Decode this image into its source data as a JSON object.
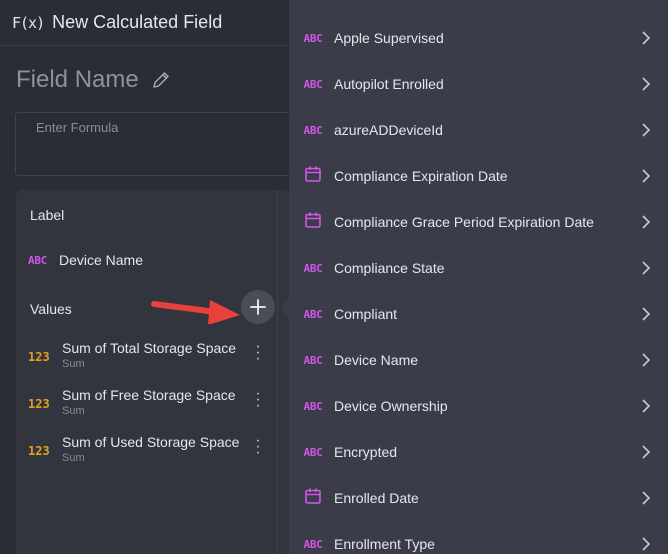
{
  "header": {
    "fx_icon": "F(x)",
    "title": "New Calculated Field"
  },
  "field_name": {
    "title": "Field Name",
    "edit_icon": "pencil-icon"
  },
  "formula": {
    "placeholder": "Enter Formula"
  },
  "label_section": {
    "heading": "Label",
    "item": {
      "badge": "ABC",
      "name": "Device Name"
    }
  },
  "values_section": {
    "heading": "Values",
    "items": [
      {
        "badge": "123",
        "name": "Sum of Total Storage Space",
        "agg": "Sum"
      },
      {
        "badge": "123",
        "name": "Sum of Free Storage Space",
        "agg": "Sum"
      },
      {
        "badge": "123",
        "name": "Sum of Used Storage Space",
        "agg": "Sum"
      }
    ]
  },
  "add_button": {
    "icon": "plus-icon"
  },
  "dropdown": {
    "items": [
      {
        "type": "text",
        "badge": "ABC",
        "label": "Apple Supervised"
      },
      {
        "type": "text",
        "badge": "ABC",
        "label": "Autopilot Enrolled"
      },
      {
        "type": "text",
        "badge": "ABC",
        "label": "azureADDeviceId"
      },
      {
        "type": "date",
        "badge": "",
        "label": "Compliance Expiration Date"
      },
      {
        "type": "date",
        "badge": "",
        "label": "Compliance Grace Period Expiration Date"
      },
      {
        "type": "text",
        "badge": "ABC",
        "label": "Compliance State"
      },
      {
        "type": "text",
        "badge": "ABC",
        "label": "Compliant"
      },
      {
        "type": "text",
        "badge": "ABC",
        "label": "Device Name"
      },
      {
        "type": "text",
        "badge": "ABC",
        "label": "Device Ownership"
      },
      {
        "type": "text",
        "badge": "ABC",
        "label": "Encrypted"
      },
      {
        "type": "date",
        "badge": "",
        "label": "Enrolled Date"
      },
      {
        "type": "text",
        "badge": "ABC",
        "label": "Enrollment Type"
      }
    ]
  },
  "colors": {
    "text_badge": "#d356e8",
    "number_badge": "#e3a020",
    "arrow": "#e8413c"
  }
}
